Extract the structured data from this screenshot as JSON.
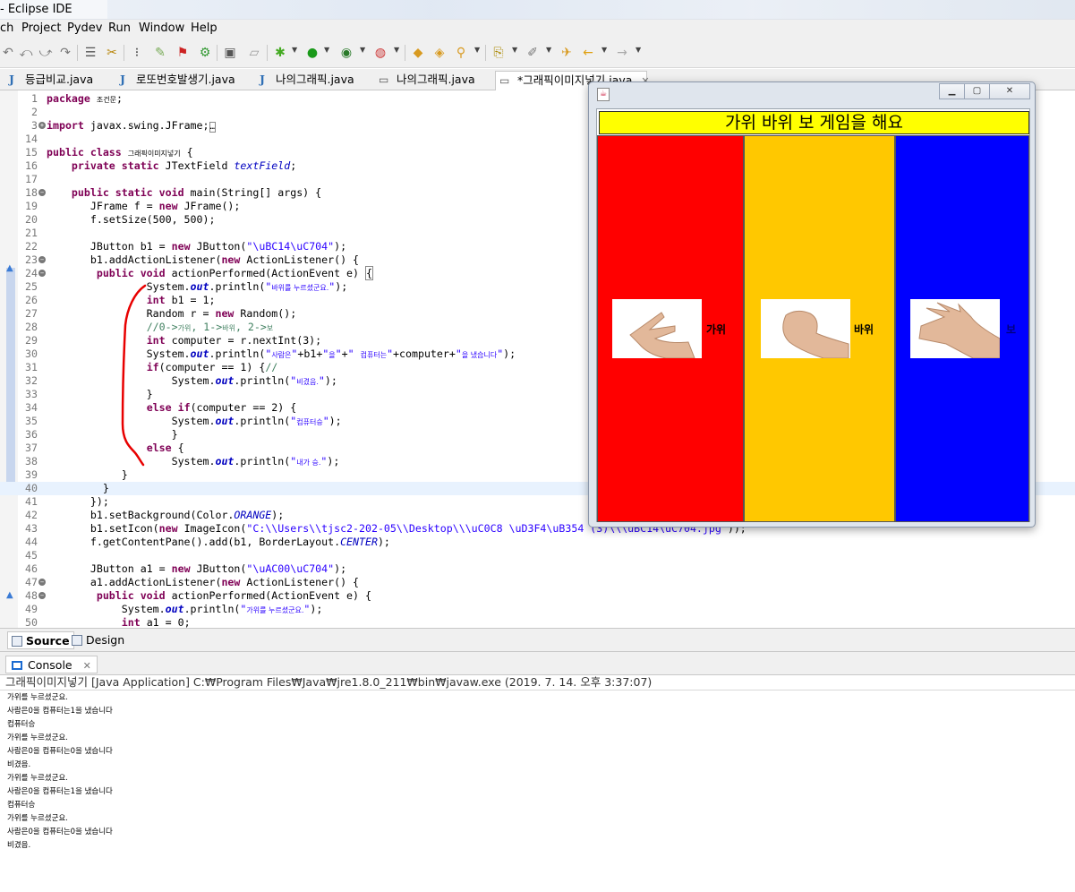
{
  "window": {
    "title": "- Eclipse IDE"
  },
  "menu": [
    "ch",
    "Project",
    "Pydev",
    "Run",
    "Window",
    "Help"
  ],
  "tabs": [
    {
      "label": "등급비교.java",
      "active": false
    },
    {
      "label": "로또번호발생기.java",
      "active": false
    },
    {
      "label": "나의그래픽.java",
      "active": false
    },
    {
      "label": "나의그래픽.java",
      "active": false
    },
    {
      "label": "*그래픽이미지넣기.java",
      "active": true
    }
  ],
  "editor": {
    "line_numbers": [
      "1",
      "2",
      "3",
      "14",
      "15",
      "16",
      "17",
      "18",
      "19",
      "20",
      "21",
      "22",
      "23",
      "24",
      "25",
      "26",
      "27",
      "28",
      "29",
      "30",
      "31",
      "32",
      "33",
      "34",
      "35",
      "36",
      "37",
      "38",
      "39",
      "40",
      "41",
      "42",
      "43",
      "44",
      "45",
      "46",
      "47",
      "48",
      "49",
      "50"
    ]
  },
  "bottom_tabs": {
    "source": "Source",
    "design": "Design"
  },
  "console": {
    "tab_label": "Console",
    "header": "그래픽이미지넣기 [Java Application] C:₩Program Files₩Java₩jre1.8.0_211₩bin₩javaw.exe (2019. 7. 14. 오후 3:37:07)",
    "lines": [
      "가위를 누르셨군요.",
      "사람은0을 컴퓨터는1을 냈습니다",
      "컴퓨터승",
      "가위를 누르셨군요.",
      "사람은0을 컴퓨터는0을 냈습니다",
      "비겼음.",
      "가위를 누르셨군요.",
      "사람은0을 컴퓨터는1을 냈습니다",
      "컴퓨터승",
      "가위를 누르셨군요.",
      "사람은0을 컴퓨터는0을 냈습니다",
      "비겼음."
    ]
  },
  "java_app": {
    "title_label": "가위 바위 보 게임을 해요",
    "buttons": [
      {
        "label": "가위",
        "color": "#ff0000"
      },
      {
        "label": "바위",
        "color": "#ffc800"
      },
      {
        "label": "보",
        "color": "#0000ff"
      }
    ]
  },
  "colors": {
    "panel_red": "#ff0000",
    "panel_orange": "#ffc800",
    "panel_blue": "#0000ff",
    "title_yellow": "#ffff00"
  }
}
